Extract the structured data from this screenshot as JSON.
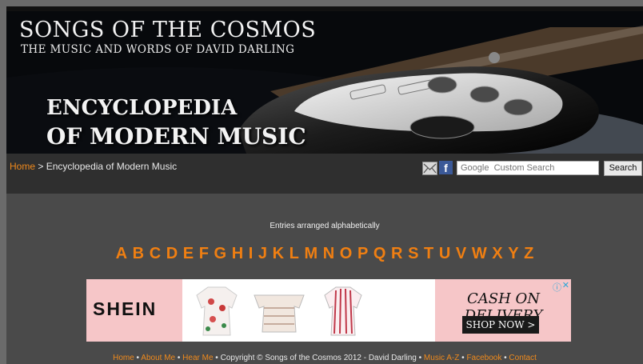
{
  "banner": {
    "title": "SONGS OF THE COSMOS",
    "subtitle": "THE MUSIC AND WORDS OF DAVID DARLING",
    "heading_line1": "ENCYCLOPEDIA",
    "heading_line2": "OF MODERN MUSIC"
  },
  "breadcrumb": {
    "home": "Home",
    "separator": " > ",
    "current": "Encyclopedia of Modern Music"
  },
  "search": {
    "placeholder": "Google  Custom Search",
    "button": "Search"
  },
  "icons": {
    "mail": "mail-icon",
    "facebook": "facebook-icon"
  },
  "content": {
    "note": "Entries arranged alphabetically",
    "letters": [
      "A",
      "B",
      "C",
      "D",
      "E",
      "F",
      "G",
      "H",
      "I",
      "J",
      "K",
      "L",
      "M",
      "N",
      "O",
      "P",
      "Q",
      "R",
      "S",
      "T",
      "U",
      "V",
      "W",
      "X",
      "Y",
      "Z"
    ]
  },
  "ad": {
    "brand": "SHEIN",
    "headline": "CASH ON DELIVERY",
    "cta": "SHOP NOW >",
    "info": "ⓘ",
    "close": "✕"
  },
  "footer": {
    "links": [
      "Home",
      "About Me",
      "Hear Me"
    ],
    "copyright": "Copyright © Songs of the Cosmos 2012 - David Darling",
    "links2": [
      "Music A-Z",
      "Facebook",
      "Contact"
    ],
    "sep": " • "
  },
  "colors": {
    "accent": "#f07f12",
    "background": "#4a4a4a",
    "navbar": "#2f2f2f"
  }
}
